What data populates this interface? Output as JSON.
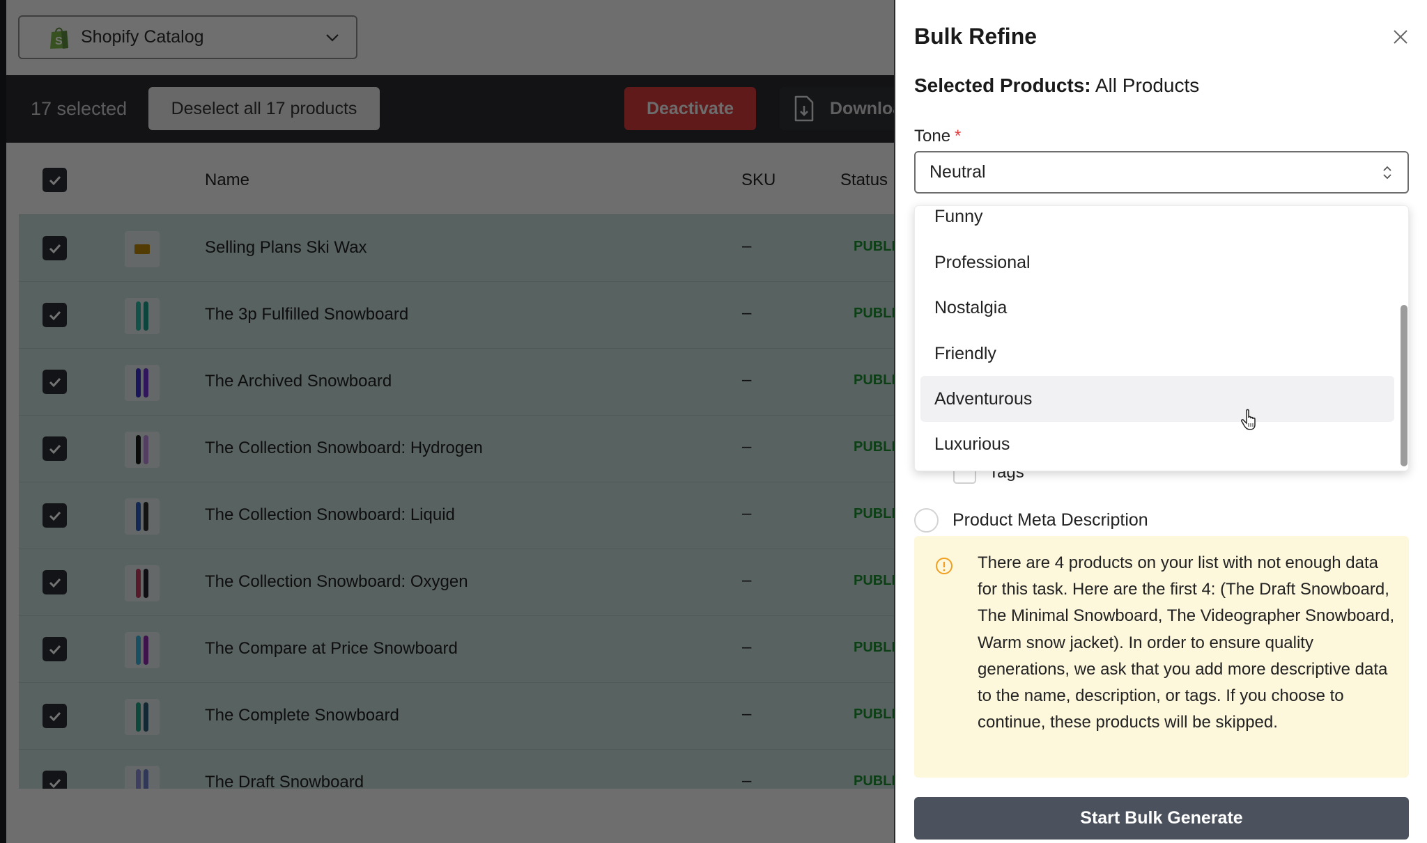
{
  "header": {
    "catalog_select": {
      "label": "Shopify Catalog",
      "icon": "shopify-bag-icon"
    }
  },
  "bulk_bar": {
    "selected_count": "17 selected",
    "deselect_label": "Deselect all 17 products",
    "deactivate_label": "Deactivate",
    "download_label": "Download",
    "download_icon": "file-download-icon"
  },
  "table": {
    "columns": [
      "",
      "",
      "Name",
      "SKU",
      "Status"
    ],
    "rows": [
      {
        "name": "Selling Plans Ski Wax",
        "sku": "–",
        "status": "PUBLISHED",
        "checked": true,
        "thumb_colors": [
          "#b8860b"
        ]
      },
      {
        "name": "The 3p Fulfilled Snowboard",
        "sku": "–",
        "status": "PUBLISHED",
        "checked": true,
        "thumb_colors": [
          "#2bb5a0",
          "#1e9a86"
        ]
      },
      {
        "name": "The Archived Snowboard",
        "sku": "–",
        "status": "PUBLISHED",
        "checked": true,
        "thumb_colors": [
          "#3b2fc9",
          "#6b34c9"
        ]
      },
      {
        "name": "The Collection Snowboard: Hydrogen",
        "sku": "–",
        "status": "PUBLISHED",
        "checked": true,
        "thumb_colors": [
          "#1a1a1a",
          "#b58bd8"
        ]
      },
      {
        "name": "The Collection Snowboard: Liquid",
        "sku": "–",
        "status": "PUBLISHED",
        "checked": true,
        "thumb_colors": [
          "#2a5ab8",
          "#2a2a2a"
        ]
      },
      {
        "name": "The Collection Snowboard: Oxygen",
        "sku": "–",
        "status": "PUBLISHED",
        "checked": true,
        "thumb_colors": [
          "#c03a60",
          "#1f1f2a"
        ]
      },
      {
        "name": "The Compare at Price Snowboard",
        "sku": "–",
        "status": "PUBLISHED",
        "checked": true,
        "thumb_colors": [
          "#3ab0d8",
          "#8a2aa8"
        ]
      },
      {
        "name": "The Complete Snowboard",
        "sku": "–",
        "status": "PUBLISHED",
        "checked": true,
        "thumb_colors": [
          "#1fa080",
          "#2a5a70"
        ]
      },
      {
        "name": "The Draft Snowboard",
        "sku": "–",
        "status": "PUBLISHED",
        "checked": true,
        "thumb_colors": [
          "#8a8ad8",
          "#6a7ac0"
        ]
      }
    ]
  },
  "drawer": {
    "title": "Bulk Refine",
    "selected_products_label": "Selected Products:",
    "selected_products_value": "All Products",
    "tone_label": "Tone",
    "tone_required_mark": "*",
    "tone_value": "Neutral",
    "tone_options_visible": [
      "Funny",
      "Professional",
      "Nostalgia",
      "Friendly",
      "Adventurous",
      "Luxurious"
    ],
    "tone_hovered": "Adventurous",
    "tags_label": "Tags",
    "meta_description_label": "Product Meta Description",
    "warning_text": "There are 4 products on your list with not enough data for this task. Here are the first 4: (The Draft Snowboard, The Minimal Snowboard, The Videographer Snowboard, Warm snow jacket). In order to ensure quality generations, we ask that you add more descriptive data to the name, description, or tags. If you choose to continue, these products will be skipped.",
    "start_button_label": "Start Bulk Generate"
  },
  "colors": {
    "deactivate": "#d43b3b",
    "status_published": "#1a8c2e",
    "warning_bg": "#fdf7dc",
    "warning_icon": "#f0a020",
    "required": "#e23c3c",
    "primary_button": "#4b525d"
  }
}
